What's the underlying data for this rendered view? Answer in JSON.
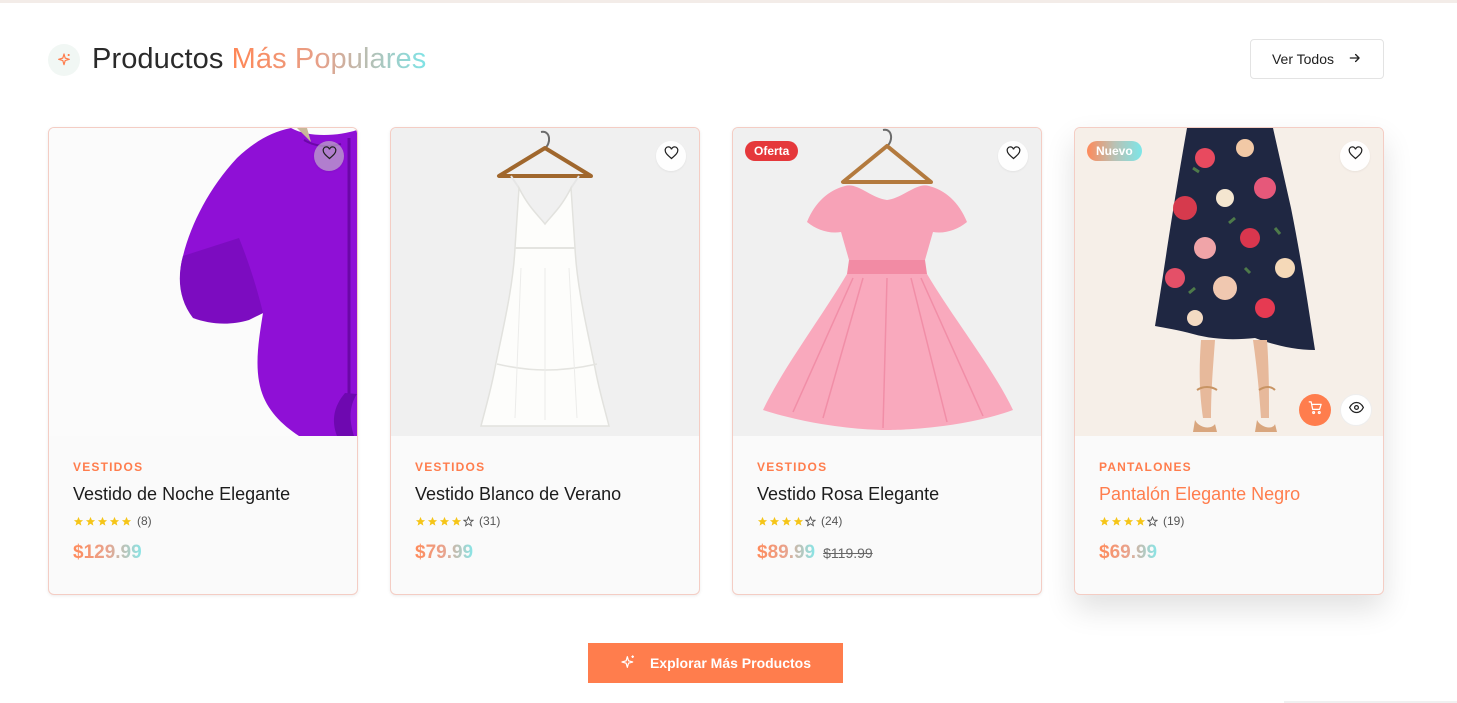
{
  "header": {
    "title_part1": "Productos ",
    "title_part2": "Más Populares",
    "view_all_label": "Ver Todos"
  },
  "products": [
    {
      "category": "VESTIDOS",
      "name": "Vestido de Noche Elegante",
      "rating": 5,
      "reviews": "(8)",
      "price": "$129.99",
      "badge": "",
      "old_price": ""
    },
    {
      "category": "VESTIDOS",
      "name": "Vestido Blanco de Verano",
      "rating": 4,
      "reviews": "(31)",
      "price": "$79.99",
      "badge": "",
      "old_price": ""
    },
    {
      "category": "VESTIDOS",
      "name": "Vestido Rosa Elegante",
      "rating": 4,
      "reviews": "(24)",
      "price": "$89.99",
      "badge": "Oferta",
      "old_price": "$119.99"
    },
    {
      "category": "PANTALONES",
      "name": "Pantalón Elegante Negro",
      "rating": 4,
      "reviews": "(19)",
      "price": "$69.99",
      "badge": "Nuevo",
      "old_price": ""
    }
  ],
  "explore_label": "Explorar Más Productos",
  "colors": {
    "accent": "#ff7d4d",
    "star": "#f5c518",
    "sale_badge": "#e5383b",
    "card_border": "#f4cdc4"
  },
  "icons": [
    "sparkle-icon",
    "arrow-right-icon",
    "heart-icon",
    "cart-icon",
    "eye-icon",
    "star-icon"
  ]
}
